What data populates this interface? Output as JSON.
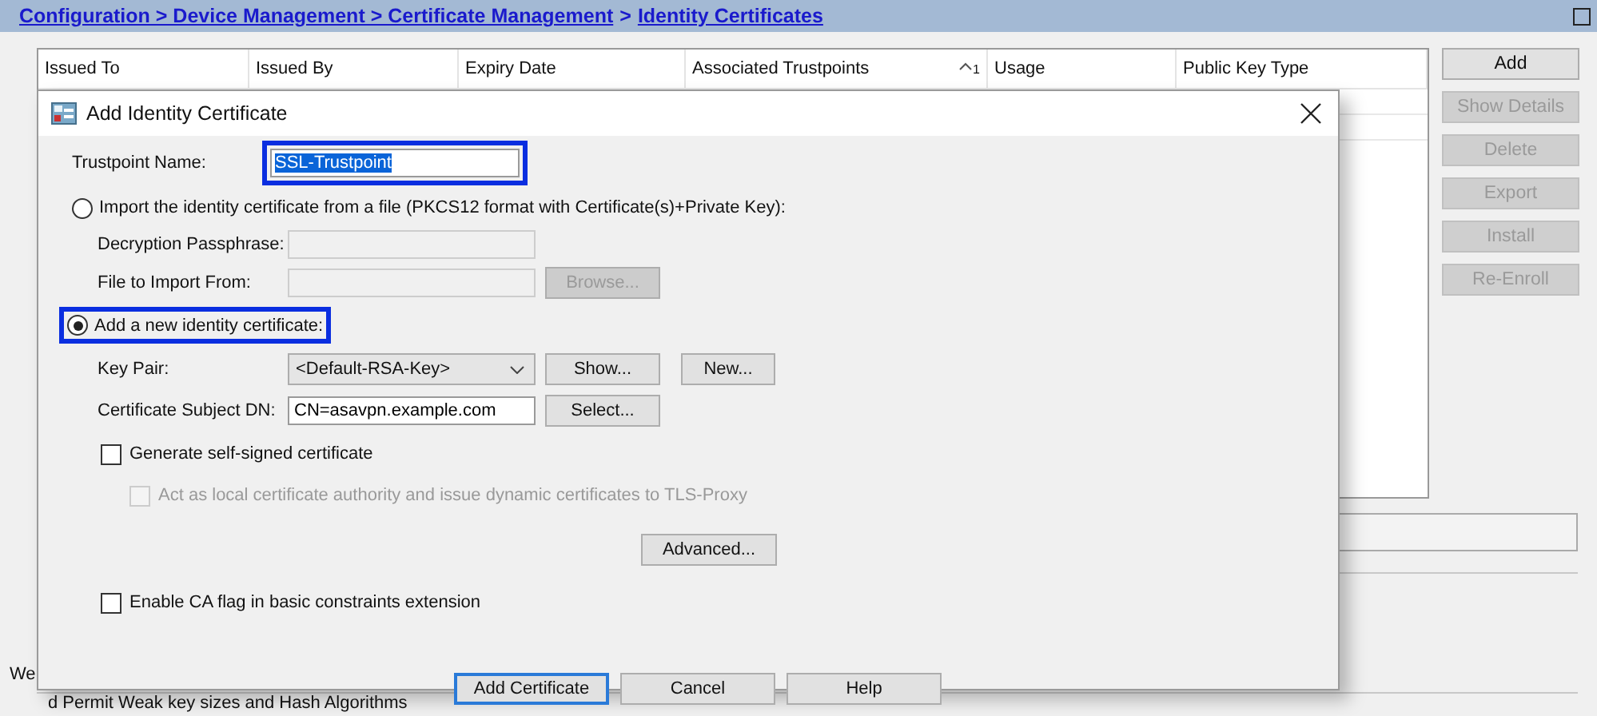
{
  "breadcrumb": {
    "path": "Configuration > Device Management > Certificate Management",
    "separator": ">",
    "current": "Identity Certificates"
  },
  "table": {
    "columns": [
      {
        "label": "Issued To",
        "sorted": false
      },
      {
        "label": "Issued By",
        "sorted": false
      },
      {
        "label": "Expiry Date",
        "sorted": false
      },
      {
        "label": "Associated Trustpoints",
        "sorted": true,
        "sort_rank": "1"
      },
      {
        "label": "Usage",
        "sorted": false
      },
      {
        "label": "Public Key Type",
        "sorted": false
      }
    ]
  },
  "side_buttons": [
    {
      "label": "Add",
      "disabled": false
    },
    {
      "label": "Show Details",
      "disabled": true
    },
    {
      "label": "Delete",
      "disabled": true
    },
    {
      "label": "Export",
      "disabled": true
    },
    {
      "label": "Install",
      "disabled": true
    },
    {
      "label": "Re-Enroll",
      "disabled": true
    }
  ],
  "background_texts": [
    "We",
    "d Permit Weak key sizes and Hash Algorithms"
  ],
  "dialog": {
    "title": "Add Identity Certificate",
    "trustpoint": {
      "label": "Trustpoint Name:",
      "value": "SSL-Trustpoint",
      "highlighted": true
    },
    "import_option": {
      "label": "Import the identity certificate from a file (PKCS12 format with Certificate(s)+Private Key):",
      "selected": false,
      "fields": [
        {
          "label": "Decryption Passphrase:",
          "disabled": true
        },
        {
          "label": "File to Import From:",
          "disabled": true,
          "button": {
            "label": "Browse...",
            "disabled": true
          }
        }
      ]
    },
    "new_option": {
      "label": "Add a new identity certificate:",
      "selected": true,
      "highlighted": true
    },
    "key_pair": {
      "label": "Key Pair:",
      "value": "<Default-RSA-Key>",
      "buttons": [
        "Show...",
        "New..."
      ]
    },
    "subject_dn": {
      "label": "Certificate Subject DN:",
      "value": "CN=asavpn.example.com",
      "button": "Select..."
    },
    "self_signed": {
      "label": "Generate self-signed certificate",
      "checked": false,
      "disabled": false,
      "children": [
        {
          "label": "Act as local certificate authority and issue dynamic certificates to TLS-Proxy",
          "checked": false,
          "disabled": true
        }
      ]
    },
    "advanced_button": "Advanced...",
    "ca_flag": {
      "label": "Enable CA flag in basic constraints extension",
      "checked": false,
      "disabled": false
    },
    "footer_buttons": [
      {
        "label": "Add Certificate",
        "default": true
      },
      {
        "label": "Cancel",
        "default": false
      },
      {
        "label": "Help",
        "default": false
      }
    ]
  }
}
